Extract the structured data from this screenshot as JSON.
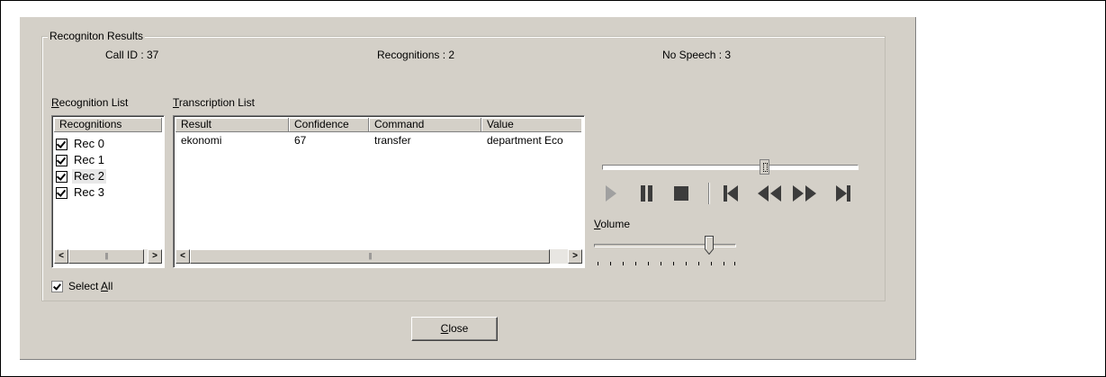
{
  "group": {
    "title": "Recogniton Results"
  },
  "stats": {
    "call_id": "Call ID : 37",
    "recognitions": "Recognitions : 2",
    "no_speech": "No Speech : 3"
  },
  "recognition_list": {
    "label_mnemonic": "R",
    "label_rest": "ecognition List",
    "header": "Recognitions",
    "items": [
      {
        "label": "Rec  0",
        "checked": true,
        "selected": false
      },
      {
        "label": "Rec  1",
        "checked": true,
        "selected": false
      },
      {
        "label": "Rec  2",
        "checked": true,
        "selected": true
      },
      {
        "label": "Rec  3",
        "checked": true,
        "selected": false
      }
    ]
  },
  "transcription_list": {
    "label_mnemonic": "T",
    "label_rest": "ranscription List",
    "columns": [
      "Result",
      "Confidence",
      "Command",
      "Value"
    ],
    "rows": [
      {
        "result": "ekonomi",
        "confidence": "67",
        "command": "transfer",
        "value": "department Eco"
      }
    ]
  },
  "select_all": {
    "prefix": "Select ",
    "mnemonic": "A",
    "rest": "ll",
    "checked": true
  },
  "volume": {
    "mnemonic": "V",
    "rest": "olume",
    "level": 0.8
  },
  "seek": {
    "position": 0.62
  },
  "close_button": {
    "mnemonic": "C",
    "rest": "lose"
  },
  "icons": [
    "play-icon",
    "pause-icon",
    "stop-icon",
    "skip-back-icon",
    "rewind-icon",
    "fast-forward-icon",
    "skip-forward-icon"
  ],
  "colors": {
    "face": "#d4d0c8",
    "transport_active": "#3c3c3c",
    "transport_disabled": "#a0a0a0"
  }
}
